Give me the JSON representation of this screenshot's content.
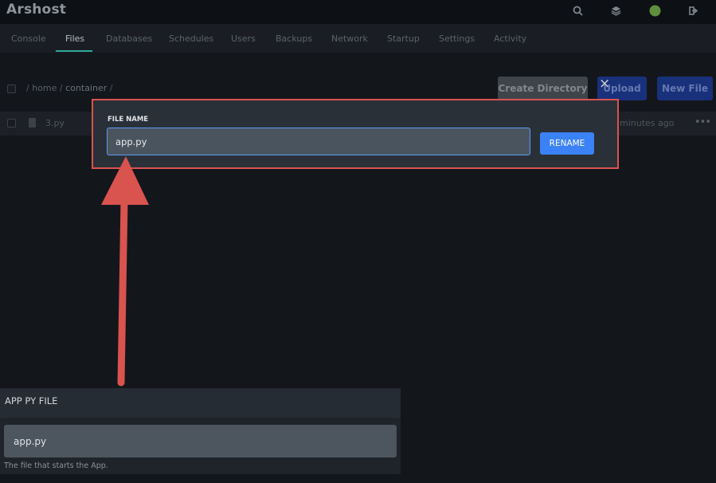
{
  "app": {
    "title": "Arshost"
  },
  "topbar": {
    "icons": [
      "search-icon",
      "layers-icon",
      "status-dot-icon",
      "logout-icon"
    ],
    "status_color": "#6aa84f"
  },
  "tabs": [
    {
      "label": "Console"
    },
    {
      "label": "Files",
      "active": true
    },
    {
      "label": "Databases"
    },
    {
      "label": "Schedules"
    },
    {
      "label": "Users"
    },
    {
      "label": "Backups"
    },
    {
      "label": "Network"
    },
    {
      "label": "Startup"
    },
    {
      "label": "Settings"
    },
    {
      "label": "Activity"
    }
  ],
  "breadcrumb": {
    "sep": "/",
    "root": "home",
    "current": "container"
  },
  "toolbar": {
    "create_directory": "Create Directory",
    "upload": "Upload",
    "new_file": "New File"
  },
  "files": [
    {
      "name": "3.py",
      "modified": "minutes ago",
      "menu": "•••"
    }
  ],
  "modal": {
    "close": "×",
    "label": "FILE NAME",
    "value": "app.py",
    "button": "RENAME",
    "border_color": "#d9534f",
    "accent": "#3b82f6"
  },
  "annotation": {
    "arrow_color": "#d9534f"
  },
  "inset": {
    "title": "APP PY FILE",
    "value": "app.py",
    "help": "The file that starts the App."
  }
}
